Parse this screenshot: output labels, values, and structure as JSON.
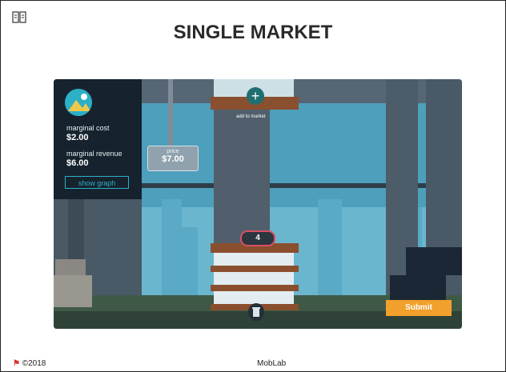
{
  "title": "SINGLE MARKET",
  "icons": {
    "top_left": "slides-icon",
    "avatar": "landscape-icon",
    "add": "plus-icon",
    "trash": "trash-icon",
    "logo": "moblab-logo-icon"
  },
  "panel": {
    "marginal_cost_label": "marginal cost",
    "marginal_cost_value": "$2.00",
    "marginal_revenue_label": "marginal revenue",
    "marginal_revenue_value": "$6.00",
    "show_graph_label": "show graph"
  },
  "price_sign": {
    "label": "price",
    "value": "$7.00"
  },
  "add_market": {
    "label": "add to market"
  },
  "production_count": "4",
  "submit_label": "Submit",
  "footer": {
    "copyright": "©2018",
    "center": "MobLab"
  },
  "colors": {
    "accent": "#2bb0c6",
    "submit": "#f2a02c",
    "counter_border": "#d94f67"
  }
}
